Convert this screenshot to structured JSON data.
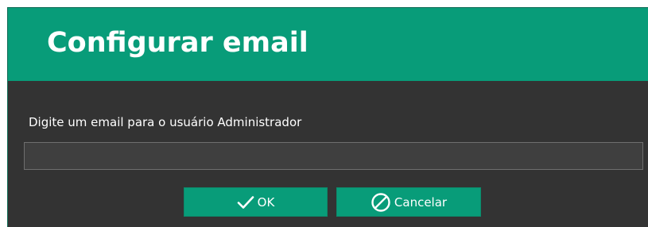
{
  "dialog": {
    "title": "Configurar email",
    "prompt": "Digite um email para o usuário Administrador",
    "email_input": {
      "value": "",
      "placeholder": ""
    },
    "buttons": {
      "ok": {
        "label": "OK",
        "icon": "check-icon"
      },
      "cancel": {
        "label": "Cancelar",
        "icon": "cancel-icon"
      }
    }
  },
  "colors": {
    "accent": "#089c79",
    "background": "#333333",
    "input_background": "#3f3f3f",
    "text": "#ffffff"
  }
}
